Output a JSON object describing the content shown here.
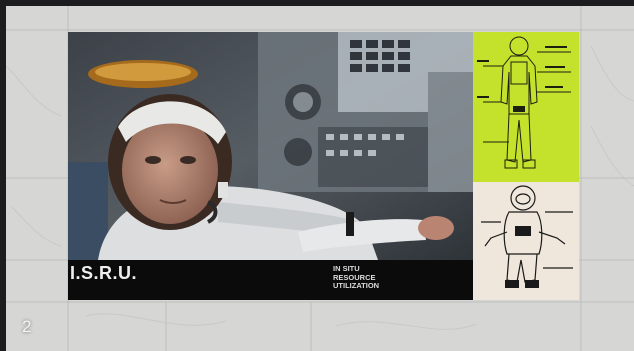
{
  "film": {
    "caption_title": "I.S.R.U.",
    "caption_desc_lines": [
      "IN SITU",
      "RESOURCE",
      "UTILIZATION"
    ]
  },
  "slide_number": "2",
  "colors": {
    "background": "#1c1c1e",
    "stage": "#d4d4d2",
    "panel_green": "#c4e12c",
    "panel_cream": "#efe7dc",
    "caption_bar": "#0b0b0c"
  },
  "icons": [
    "astronaut-photo",
    "spacesuit-schematic-icon",
    "seated-astronaut-sketch-icon"
  ]
}
